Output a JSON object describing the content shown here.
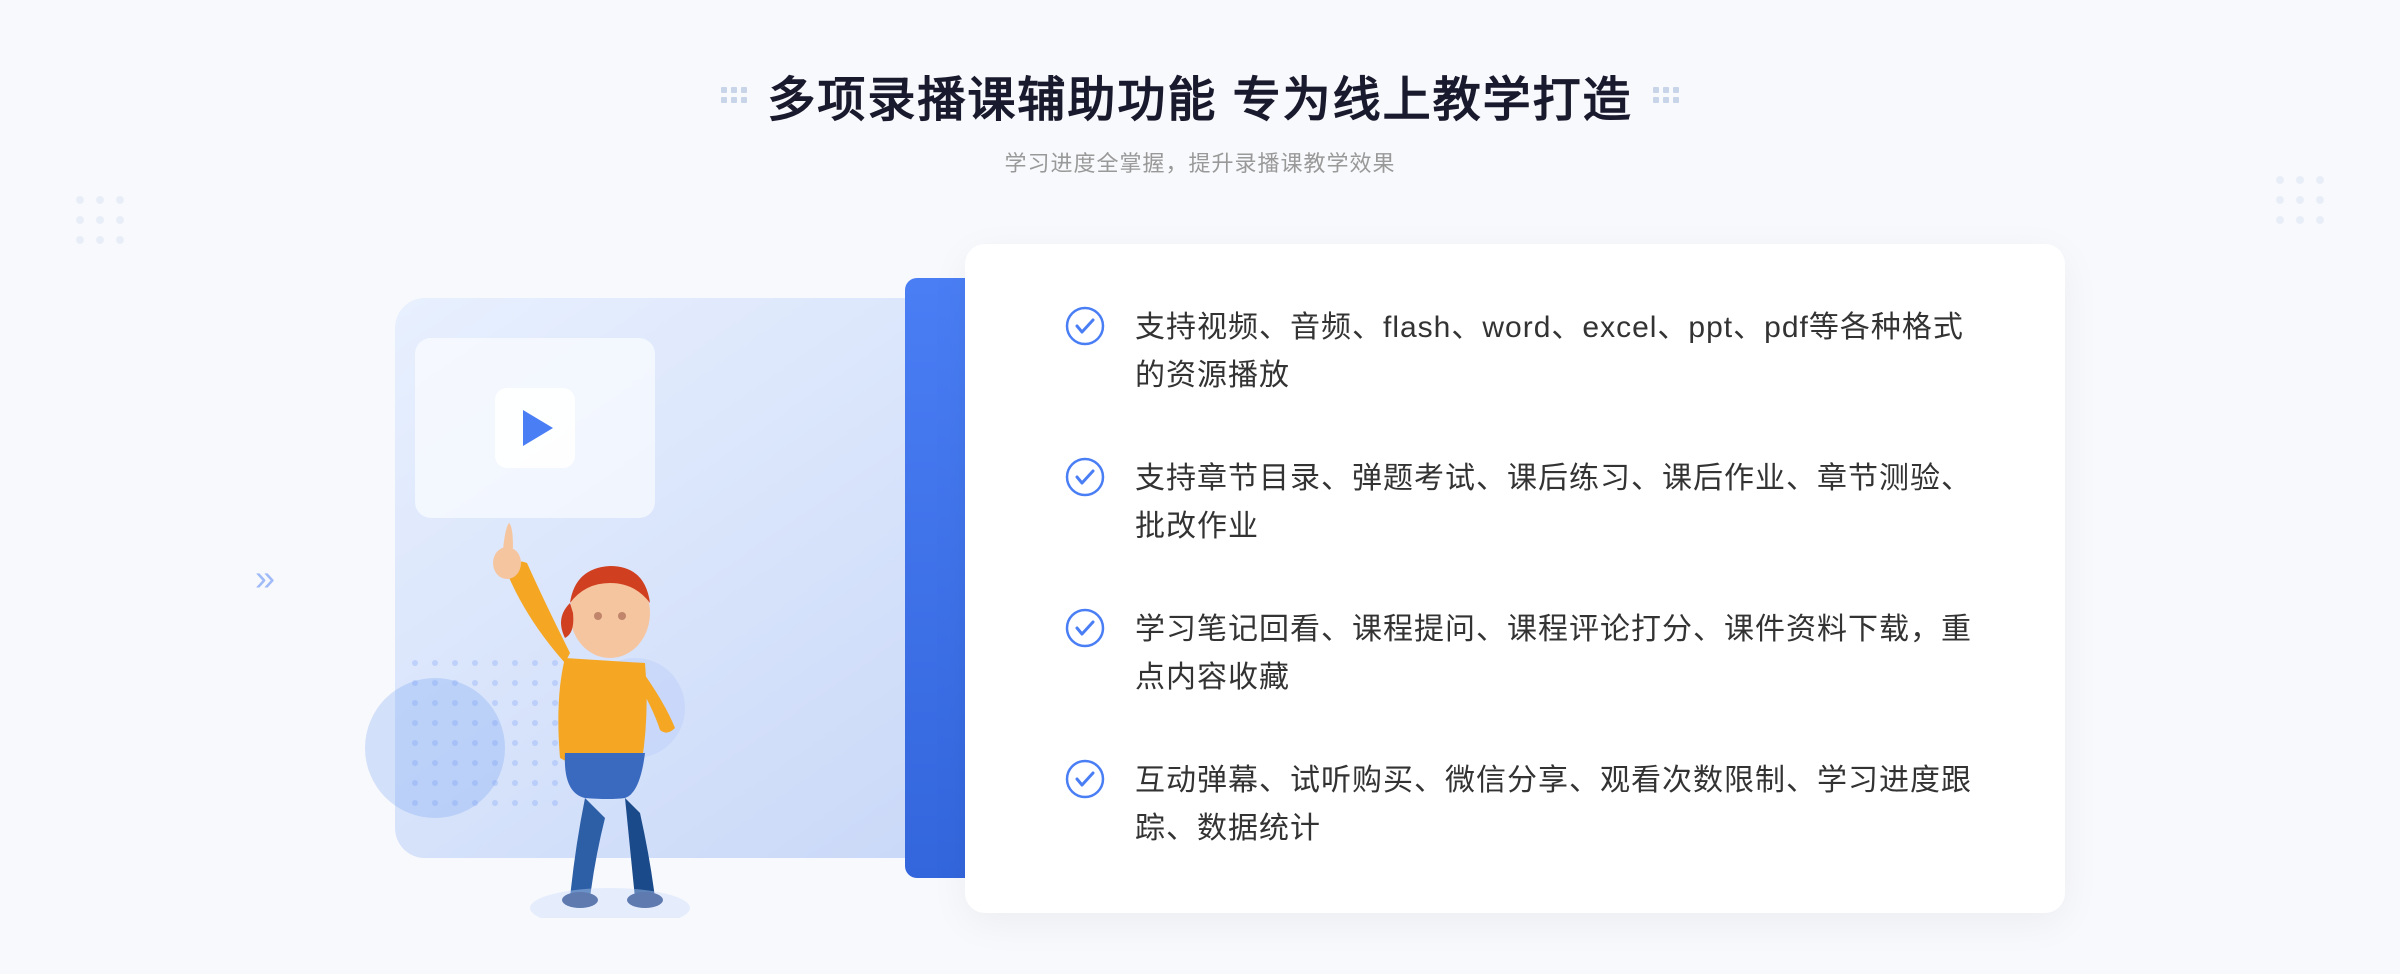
{
  "header": {
    "title": "多项录播课辅助功能 专为线上教学打造",
    "subtitle": "学习进度全掌握，提升录播课教学效果"
  },
  "features": [
    {
      "id": "feature-1",
      "text": "支持视频、音频、flash、word、excel、ppt、pdf等各种格式的资源播放"
    },
    {
      "id": "feature-2",
      "text": "支持章节目录、弹题考试、课后练习、课后作业、章节测验、批改作业"
    },
    {
      "id": "feature-3",
      "text": "学习笔记回看、课程提问、课程评论打分、课件资料下载，重点内容收藏"
    },
    {
      "id": "feature-4",
      "text": "互动弹幕、试听购买、微信分享、观看次数限制、学习进度跟踪、数据统计"
    }
  ],
  "colors": {
    "primary_blue": "#4a7ef5",
    "light_blue": "#e8f0fe",
    "text_dark": "#1a1a2e",
    "text_gray": "#999999",
    "text_body": "#333333",
    "check_color": "#4a7ef5"
  }
}
